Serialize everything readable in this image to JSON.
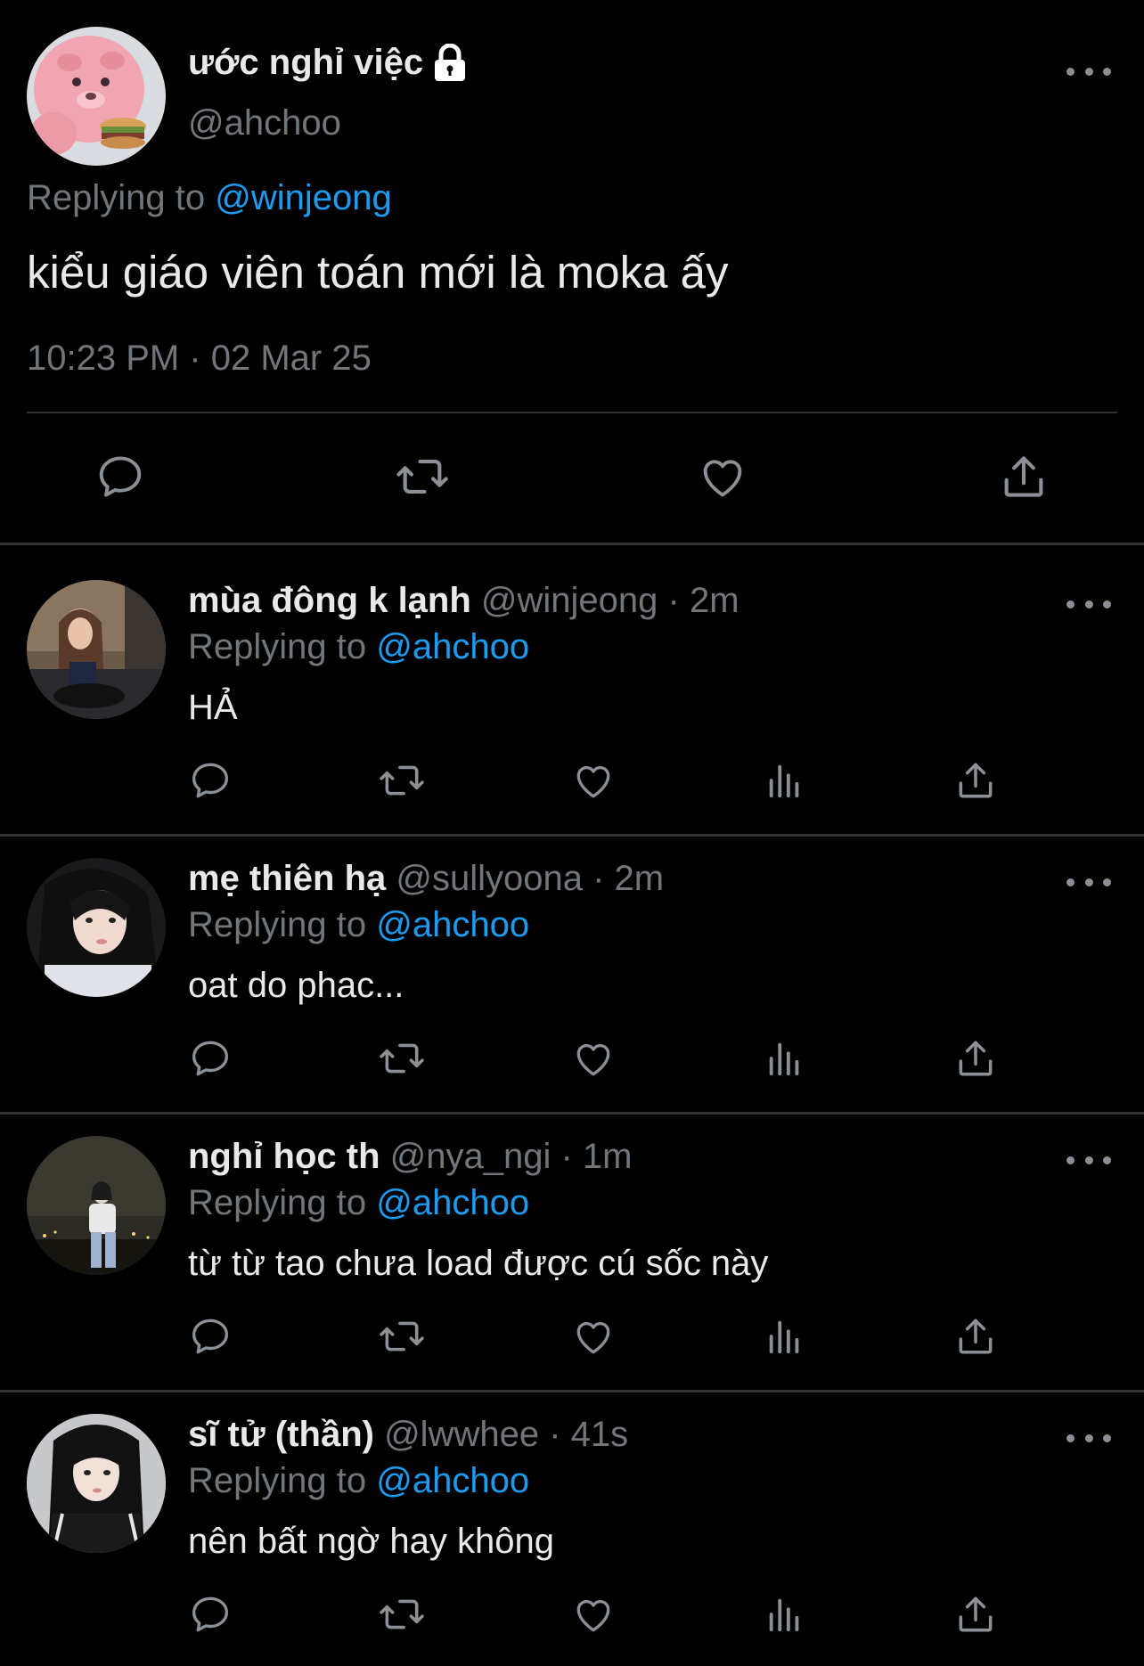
{
  "main_tweet": {
    "display_name": "ước nghỉ việc",
    "handle": "@ahchoo",
    "replying_prefix": "Replying to",
    "replying_to": "@winjeong",
    "text": "kiểu giáo viên toán mới là moka ấy",
    "timestamp": "10:23 PM · 02 Mar 25",
    "icons": [
      "reply-icon",
      "retweet-icon",
      "like-icon",
      "share-icon",
      "more-icon",
      "lock-icon"
    ]
  },
  "replies": [
    {
      "display_name": "mùa đông k lạnh",
      "handle": "@winjeong",
      "time": "· 2m",
      "replying_prefix": "Replying to",
      "replying_to": "@ahchoo",
      "text": "HẢ"
    },
    {
      "display_name": "mẹ thiên hạ",
      "handle": "@sullyoona",
      "time": "· 2m",
      "replying_prefix": "Replying to",
      "replying_to": "@ahchoo",
      "text": "oat do phac..."
    },
    {
      "display_name": "nghỉ học th",
      "handle": "@nya_ngi",
      "time": "· 1m",
      "replying_prefix": "Replying to",
      "replying_to": "@ahchoo",
      "text": "từ từ tao chưa load được cú sốc này"
    },
    {
      "display_name": "sĩ tử (thần)",
      "handle": "@lwwhee",
      "time": "· 41s",
      "replying_prefix": "Replying to",
      "replying_to": "@ahchoo",
      "text": "nên bất ngờ hay không"
    }
  ],
  "reply_action_icons": [
    "reply-icon",
    "retweet-icon",
    "like-icon",
    "views-icon",
    "share-icon"
  ],
  "colors": {
    "background": "#000000",
    "text": "#e7e9ea",
    "secondary": "#71767b",
    "link": "#1d9bf0",
    "divider": "#2f3336"
  }
}
